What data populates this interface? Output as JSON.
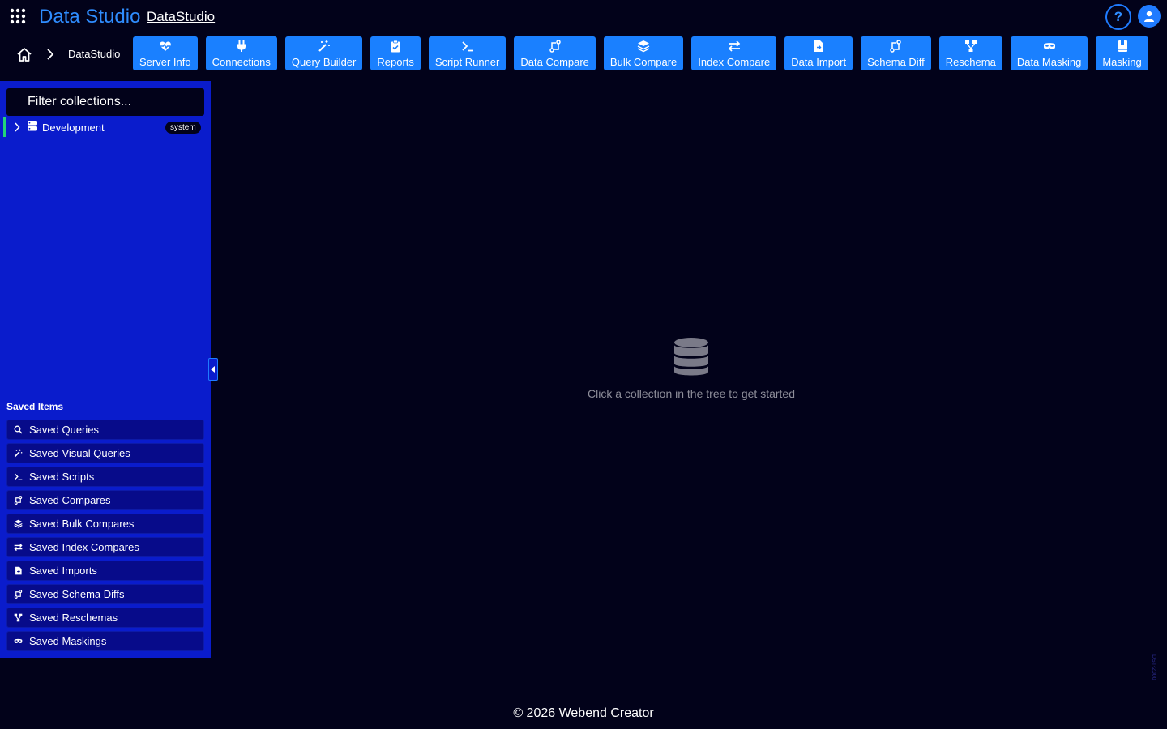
{
  "header": {
    "brand": "Data Studio",
    "brand_link": "DataStudio",
    "help_label": "?"
  },
  "breadcrumb": {
    "current": "DataStudio"
  },
  "tools": [
    {
      "label": "Server Info",
      "icon": "heart-pulse-icon"
    },
    {
      "label": "Connections",
      "icon": "plug-icon"
    },
    {
      "label": "Query Builder",
      "icon": "magic-wand-icon"
    },
    {
      "label": "Reports",
      "icon": "clipboard-check-icon"
    },
    {
      "label": "Script Runner",
      "icon": "terminal-icon"
    },
    {
      "label": "Data Compare",
      "icon": "compare-arrows-icon"
    },
    {
      "label": "Bulk Compare",
      "icon": "layers-icon"
    },
    {
      "label": "Index Compare",
      "icon": "swap-arrows-icon"
    },
    {
      "label": "Data Import",
      "icon": "file-import-icon"
    },
    {
      "label": "Schema Diff",
      "icon": "compare-arrows-icon"
    },
    {
      "label": "Reschema",
      "icon": "diagram-icon"
    },
    {
      "label": "Data Masking",
      "icon": "mask-icon"
    },
    {
      "label": "Masking",
      "icon": "book-icon"
    }
  ],
  "sidebar": {
    "filter_placeholder": "Filter collections...",
    "tree": [
      {
        "label": "Development",
        "badge": "system",
        "icon": "database-icon"
      }
    ],
    "saved_title": "Saved Items",
    "saved_items": [
      {
        "label": "Saved Queries",
        "icon": "search-icon"
      },
      {
        "label": "Saved Visual Queries",
        "icon": "magic-wand-icon"
      },
      {
        "label": "Saved Scripts",
        "icon": "terminal-icon"
      },
      {
        "label": "Saved Compares",
        "icon": "compare-arrows-icon"
      },
      {
        "label": "Saved Bulk Compares",
        "icon": "layers-icon"
      },
      {
        "label": "Saved Index Compares",
        "icon": "swap-arrows-icon"
      },
      {
        "label": "Saved Imports",
        "icon": "file-import-icon"
      },
      {
        "label": "Saved Schema Diffs",
        "icon": "compare-arrows-icon"
      },
      {
        "label": "Saved Reschemas",
        "icon": "diagram-icon"
      },
      {
        "label": "Saved Maskings",
        "icon": "mask-icon"
      }
    ]
  },
  "main": {
    "empty_text": "Click a collection in the tree to get started"
  },
  "version": "DST-2000",
  "footer": "© 2026 Webend Creator",
  "colors": {
    "background": "#02021a",
    "accent": "#1a80ff",
    "sidebar": "#0a1ccc",
    "active_indicator": "#22d37a"
  }
}
